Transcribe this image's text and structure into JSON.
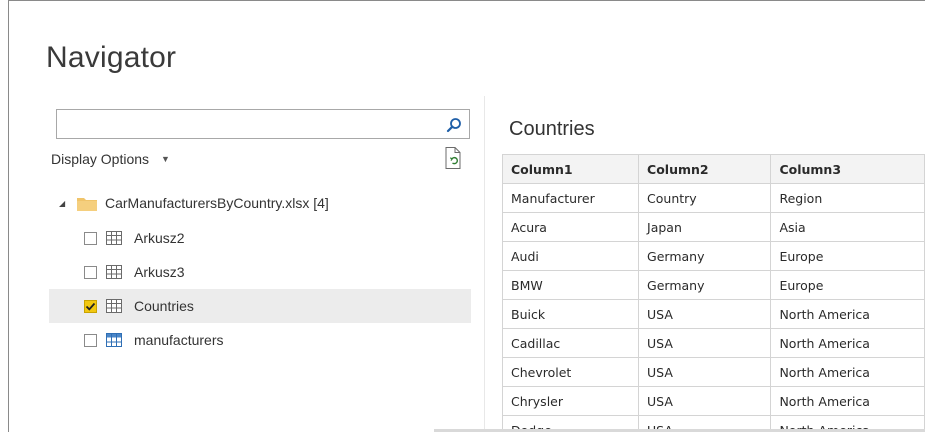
{
  "window": {
    "title": "Navigator"
  },
  "search": {
    "value": "",
    "placeholder": ""
  },
  "display_options": {
    "label": "Display Options"
  },
  "tree": {
    "root_label": "CarManufacturersByCountry.xlsx [4]",
    "items": [
      {
        "label": "Arkusz2",
        "checked": false,
        "icon": "sheet-icon"
      },
      {
        "label": "Arkusz3",
        "checked": false,
        "icon": "sheet-icon"
      },
      {
        "label": "Countries",
        "checked": true,
        "icon": "sheet-icon"
      },
      {
        "label": "manufacturers",
        "checked": false,
        "icon": "table-icon"
      }
    ]
  },
  "preview": {
    "title": "Countries",
    "columns": [
      "Column1",
      "Column2",
      "Column3"
    ],
    "rows": [
      [
        "Manufacturer",
        "Country",
        "Region"
      ],
      [
        "Acura",
        "Japan",
        "Asia"
      ],
      [
        "Audi",
        "Germany",
        "Europe"
      ],
      [
        "BMW",
        "Germany",
        "Europe"
      ],
      [
        "Buick",
        "USA",
        "North America"
      ],
      [
        "Cadillac",
        "USA",
        "North America"
      ],
      [
        "Chevrolet",
        "USA",
        "North America"
      ],
      [
        "Chrysler",
        "USA",
        "North America"
      ],
      [
        "Dodge",
        "USA",
        "North America"
      ]
    ]
  },
  "colors": {
    "checkbox_checked": "#f2c811",
    "folder": "#f0c46a",
    "selection": "#ececec"
  }
}
